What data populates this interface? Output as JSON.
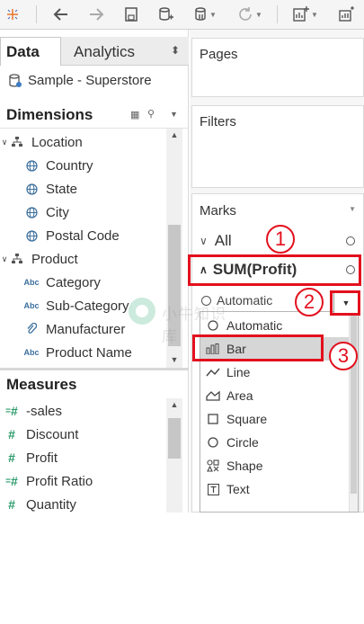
{
  "toolbar": {
    "buttons": [
      "tableau-logo-icon",
      "back-icon",
      "forward-icon",
      "save-icon",
      "new-datasource-icon",
      "pause-updates-icon",
      "refresh-icon",
      "new-worksheet-icon",
      "show-me-icon"
    ]
  },
  "left_pane": {
    "tab_data": "Data",
    "tab_analytics": "Analytics",
    "datasource": "Sample - Superstore",
    "dimensions_header": "Dimensions",
    "dimensions": [
      {
        "label": "Location",
        "icon": "hierarchy-icon",
        "level": 0
      },
      {
        "label": "Country",
        "icon": "globe-icon",
        "level": 1
      },
      {
        "label": "State",
        "icon": "globe-icon",
        "level": 1
      },
      {
        "label": "City",
        "icon": "globe-icon",
        "level": 1
      },
      {
        "label": "Postal Code",
        "icon": "globe-icon",
        "level": 1
      },
      {
        "label": "Product",
        "icon": "hierarchy-icon",
        "level": 0
      },
      {
        "label": "Category",
        "icon": "abc-icon",
        "level": 1
      },
      {
        "label": "Sub-Category",
        "icon": "abc-icon",
        "level": 1
      },
      {
        "label": "Manufacturer",
        "icon": "paperclip-icon",
        "level": 1
      },
      {
        "label": "Product Name",
        "icon": "abc-icon",
        "level": 1
      }
    ],
    "abc_text": "Abc",
    "measures_header": "Measures",
    "measures": [
      {
        "label": "-sales",
        "icon": "calc-measure-icon"
      },
      {
        "label": "Discount",
        "icon": "number-icon"
      },
      {
        "label": "Profit",
        "icon": "number-icon"
      },
      {
        "label": "Profit Ratio",
        "icon": "calc-measure-icon"
      },
      {
        "label": "Quantity",
        "icon": "number-icon"
      }
    ]
  },
  "right_pane": {
    "pages_title": "Pages",
    "filters_title": "Filters",
    "marks_title": "Marks",
    "marks_all": "All",
    "marks_measure": "SUM(Profit)",
    "mark_type_selected": "Automatic",
    "mark_types": [
      {
        "label": "Automatic",
        "icon": "automatic-icon"
      },
      {
        "label": "Bar",
        "icon": "bar-icon"
      },
      {
        "label": "Line",
        "icon": "line-icon"
      },
      {
        "label": "Area",
        "icon": "area-icon"
      },
      {
        "label": "Square",
        "icon": "square-icon"
      },
      {
        "label": "Circle",
        "icon": "circle-icon"
      },
      {
        "label": "Shape",
        "icon": "shape-icon"
      },
      {
        "label": "Text",
        "icon": "text-icon"
      }
    ],
    "highlighted_item": "Bar"
  },
  "annotations": {
    "step_1": "1",
    "step_2": "2",
    "step_3": "3",
    "color": "#e3101d"
  },
  "watermark_text": "小牛知识库"
}
